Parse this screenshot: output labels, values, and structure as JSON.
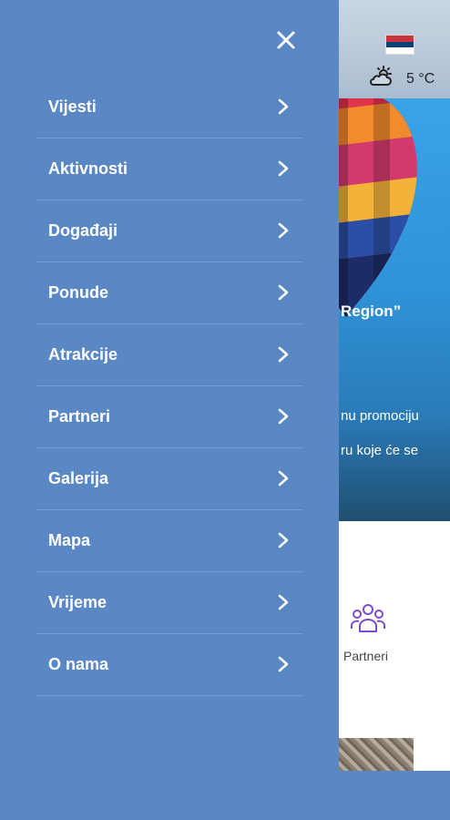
{
  "header": {
    "temperature": "5 °C",
    "weather_icon": "partly-cloudy-icon",
    "flag_icon": "serbia-flag-icon"
  },
  "hero": {
    "title_fragment": "Region”",
    "line1_fragment": "nu promociju",
    "line2_fragment": "ru koje će se"
  },
  "quick_links": {
    "partneri_label": "Partneri"
  },
  "drawer": {
    "close_icon": "close-icon",
    "items": [
      {
        "label": "Vijesti"
      },
      {
        "label": "Aktivnosti"
      },
      {
        "label": "Događaji"
      },
      {
        "label": "Ponude"
      },
      {
        "label": "Atrakcije"
      },
      {
        "label": "Partneri"
      },
      {
        "label": "Galerija"
      },
      {
        "label": "Mapa"
      },
      {
        "label": "Vrijeme"
      },
      {
        "label": "O nama"
      }
    ]
  },
  "colors": {
    "drawer_bg": "#5a88c4",
    "accent_purple": "#7b4bd1"
  }
}
